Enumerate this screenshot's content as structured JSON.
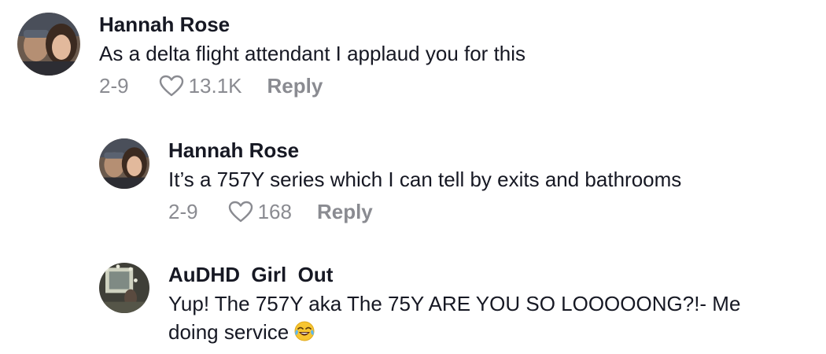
{
  "comments": [
    {
      "username": "Hannah Rose",
      "text": "As a delta flight attendant I applaud you for this",
      "date": "2-9",
      "likes": "13.1K",
      "reply_label": "Reply"
    },
    {
      "username": "Hannah Rose",
      "text": "It’s a 757Y series which I can tell by exits and bathrooms",
      "date": "2-9",
      "likes": "168",
      "reply_label": "Reply"
    },
    {
      "username": "AuDHD  Girl  Out",
      "text": "Yup! The 757Y aka The 75Y ARE YOU SO LOOOOONG?!- Me\ndoing service",
      "emoji": "laughing-tears-emoji"
    }
  ],
  "colors": {
    "text": "#161823",
    "meta": "#8a8b91"
  }
}
